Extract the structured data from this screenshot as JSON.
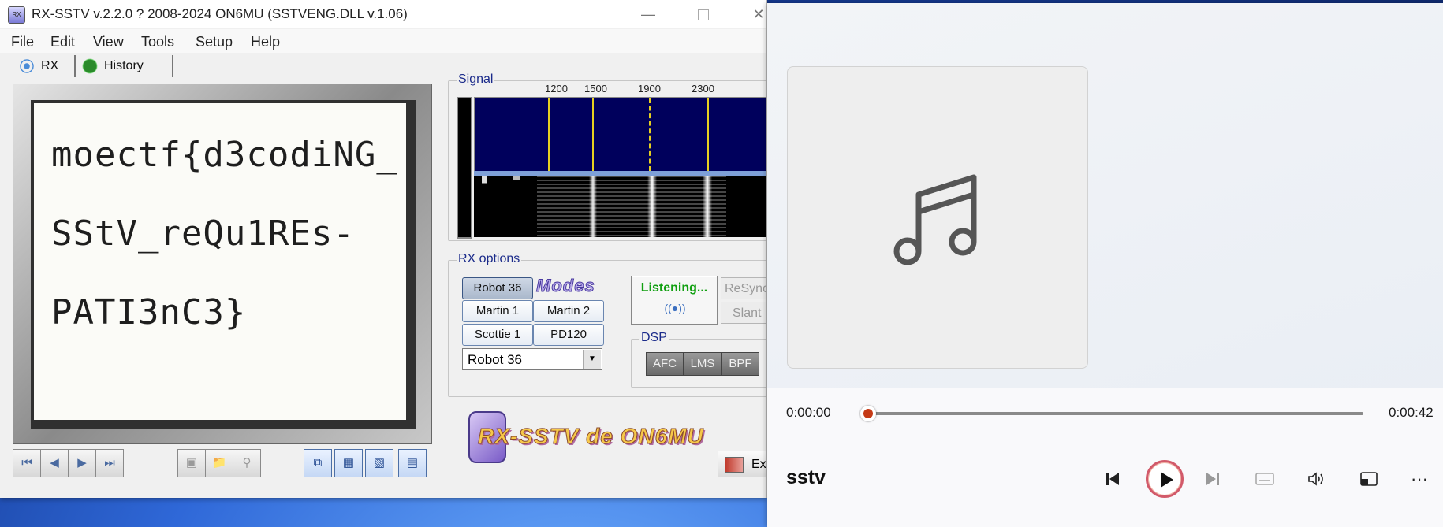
{
  "sstv_window": {
    "title": "RX-SSTV v.2.2.0 ? 2008-2024 ON6MU (SSTVENG.DLL v.1.06)",
    "menu": [
      "File",
      "Edit",
      "View",
      "Tools",
      "Setup",
      "Help"
    ],
    "tabs": {
      "rx": "RX",
      "history": "History"
    },
    "received_image_lines": [
      "moectf{d3codiNG_",
      "SStV_reQu1REs-",
      "PATI3nC3}"
    ],
    "signal": {
      "group_title": "Signal",
      "freq_labels": [
        "1200",
        "1500",
        "1900",
        "2300"
      ]
    },
    "rx_options": {
      "group_title": "RX options",
      "modes": [
        "Robot 36",
        "Martin 1",
        "Martin 2",
        "Scottie 1",
        "PD120"
      ],
      "modes_logo": "Modes",
      "selected_mode": "Robot 36",
      "status": "Listening...",
      "resync": "ReSync",
      "slant": "Slant"
    },
    "dsp": {
      "group_title": "DSP",
      "buttons": [
        "AFC",
        "LMS",
        "BPF"
      ]
    },
    "brand": "RX-SSTV de ON6MU",
    "exit": "Exi"
  },
  "player": {
    "time_current": "0:00:00",
    "time_total": "0:00:42",
    "progress_fraction": 0,
    "track_title": "sstv"
  },
  "colors": {
    "accent": "#c53a16",
    "listening_green": "#12a012",
    "spectrum_bg": "#00005c",
    "marker_yellow": "#e6d020"
  }
}
